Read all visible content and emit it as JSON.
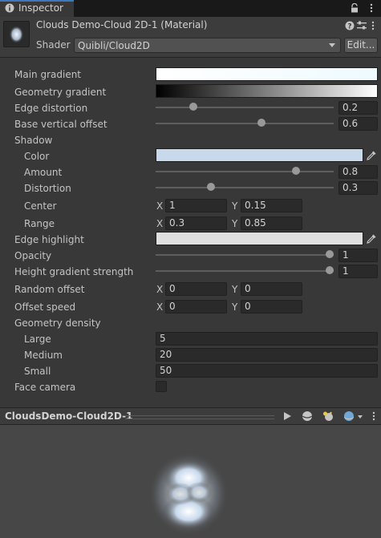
{
  "tab": {
    "label": "Inspector"
  },
  "header": {
    "title": "Clouds Demo-Cloud 2D-1 (Material)",
    "shader_label": "Shader",
    "shader_value": "Quibli/Cloud2D",
    "edit_label": "Edit..."
  },
  "props": {
    "main_gradient": "Main gradient",
    "geometry_gradient": "Geometry gradient",
    "edge_distortion": {
      "label": "Edge distortion",
      "value": "0.2",
      "fraction": 0.2
    },
    "base_vertical_offset": {
      "label": "Base vertical offset",
      "value": "0.6",
      "fraction": 0.6
    },
    "shadow": "Shadow",
    "shadow_color": "Color",
    "shadow_amount": {
      "label": "Amount",
      "value": "0.8",
      "fraction": 0.8
    },
    "shadow_distortion": {
      "label": "Distortion",
      "value": "0.3",
      "fraction": 0.3
    },
    "shadow_center": {
      "label": "Center",
      "x": "1",
      "y": "0.15"
    },
    "shadow_range": {
      "label": "Range",
      "x": "0.3",
      "y": "0.85"
    },
    "edge_highlight": "Edge highlight",
    "opacity": {
      "label": "Opacity",
      "value": "1",
      "fraction": 1
    },
    "height_gradient_strength": {
      "label": "Height gradient strength",
      "value": "1",
      "fraction": 1
    },
    "random_offset": {
      "label": "Random offset",
      "x": "0",
      "y": "0"
    },
    "offset_speed": {
      "label": "Offset speed",
      "x": "0",
      "y": "0"
    },
    "geometry_density": "Geometry density",
    "large": {
      "label": "Large",
      "value": "5"
    },
    "medium": {
      "label": "Medium",
      "value": "20"
    },
    "small": {
      "label": "Small",
      "value": "50"
    },
    "face_camera": {
      "label": "Face camera",
      "checked": false
    },
    "x_label": "X",
    "y_label": "Y"
  },
  "colors": {
    "main_gradient_start": "#ffffff",
    "main_gradient_end": "#eefaff",
    "geometry_gradient_start": "#000000",
    "geometry_gradient_end": "#ffffff",
    "shadow_color": "#c8d9ec",
    "edge_highlight": "#e0e0e0",
    "accent": "#3a79bb"
  },
  "preview": {
    "title": "CloudsDemo-Cloud2D-1"
  }
}
